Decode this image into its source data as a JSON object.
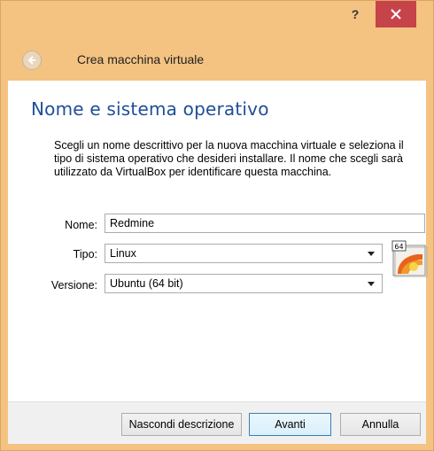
{
  "titlebar": {
    "help_label": "?",
    "close_icon": "close-icon"
  },
  "wizard": {
    "title": "Crea macchina virtuale",
    "back_icon": "back-arrow-icon"
  },
  "page": {
    "heading": "Nome e sistema operativo",
    "description": "Scegli un nome descrittivo per la nuova macchina virtuale e seleziona il tipo di sistema operativo che desideri installare. Il nome che scegli sarà utilizzato da VirtualBox per identificare questa macchina."
  },
  "form": {
    "name_label": "Nome:",
    "name_value": "Redmine",
    "type_label": "Tipo:",
    "type_value": "Linux",
    "version_label": "Versione:",
    "version_value": "Ubuntu (64 bit)",
    "os_icon_badge": "64"
  },
  "footer": {
    "hide_description_label": "Nascondi descrizione",
    "next_label": "Avanti",
    "cancel_label": "Annulla"
  },
  "colors": {
    "frame": "#f4c382",
    "close": "#c7434a",
    "heading": "#1f4e99"
  }
}
